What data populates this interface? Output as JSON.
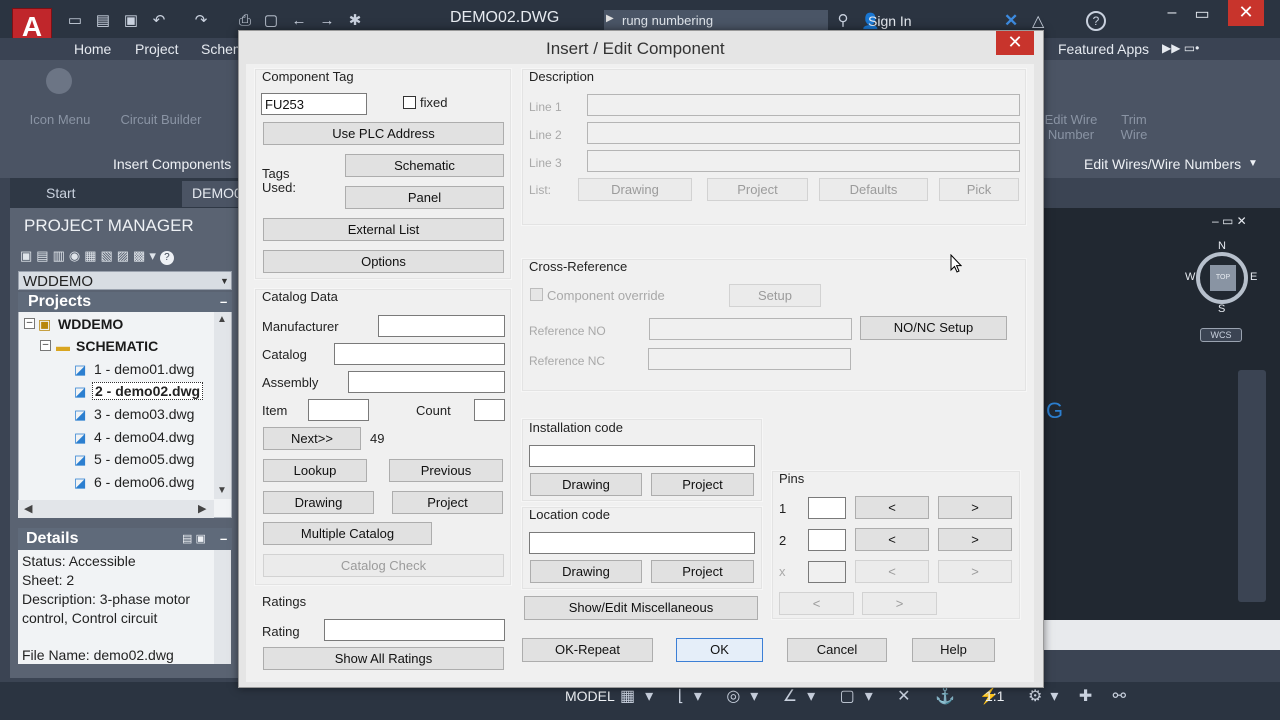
{
  "app": {
    "logo": "A",
    "file_title": "DEMO02.DWG",
    "search_text": "rung numbering",
    "sign_in": "Sign In",
    "tabs": [
      "Home",
      "Project",
      "Schem"
    ],
    "featured_apps": "Featured Apps",
    "ribbon_panel_insert": "Insert Components",
    "ribbon_panel_wires": "Edit Wires/Wire Numbers",
    "ribbon_faded": [
      "Icon Menu",
      "Circuit Builder",
      "Edit Wire Number",
      "Trim Wire"
    ],
    "doc_tabs": [
      "Start",
      "DEMO0"
    ],
    "status_model": "MODEL",
    "status_scale": "1:1"
  },
  "project_manager": {
    "title": "PROJECT MANAGER",
    "project_select": "WDDEMO",
    "projects_header": "Projects",
    "tree": {
      "project": "WDDEMO",
      "folder": "SCHEMATIC",
      "files": [
        "1 - demo01.dwg",
        "2 - demo02.dwg",
        "3 - demo03.dwg",
        "4 - demo04.dwg",
        "5 - demo05.dwg",
        "6 - demo06.dwg"
      ],
      "selected_index": 1
    },
    "details": {
      "header": "Details",
      "status": "Status: Accessible",
      "sheet": "Sheet: 2",
      "description": "Description: 3-phase motor control, Control circuit",
      "file_name": "File Name: demo02.dwg"
    }
  },
  "viewcube": {
    "top": "TOP",
    "n": "N",
    "s": "S",
    "e": "E",
    "w": "W",
    "wcs": "WCS"
  },
  "dialog": {
    "title": "Insert / Edit Component",
    "component_tag": {
      "header": "Component Tag",
      "value": "FU253",
      "fixed_label": "fixed",
      "use_plc_address": "Use PLC Address",
      "tags_used_label": "Tags Used:",
      "schematic": "Schematic",
      "panel": "Panel",
      "external_list": "External List",
      "options": "Options"
    },
    "catalog": {
      "header": "Catalog Data",
      "manufacturer_label": "Manufacturer",
      "catalog_label": "Catalog",
      "assembly_label": "Assembly",
      "item_label": "Item",
      "count_label": "Count",
      "next": "Next>>",
      "next_value": "49",
      "lookup": "Lookup",
      "previous": "Previous",
      "drawing": "Drawing",
      "project": "Project",
      "multiple_catalog": "Multiple Catalog",
      "catalog_check": "Catalog Check"
    },
    "ratings": {
      "header": "Ratings",
      "rating_label": "Rating",
      "show_all": "Show All Ratings"
    },
    "description": {
      "header": "Description",
      "line1": "Line 1",
      "line2": "Line 2",
      "line3": "Line 3",
      "list_label": "List:",
      "drawing": "Drawing",
      "project": "Project",
      "defaults": "Defaults",
      "pick": "Pick"
    },
    "cross_reference": {
      "header": "Cross-Reference",
      "component_override": "Component override",
      "setup": "Setup",
      "reference_no": "Reference NO",
      "reference_nc": "Reference NC",
      "nonc_setup": "NO/NC Setup"
    },
    "installation": {
      "header": "Installation code",
      "drawing": "Drawing",
      "project": "Project"
    },
    "location": {
      "header": "Location code",
      "drawing": "Drawing",
      "project": "Project"
    },
    "show_edit_misc": "Show/Edit Miscellaneous",
    "pins": {
      "header": "Pins",
      "row1": "1",
      "row2": "2",
      "row3": "x",
      "prev": "<",
      "next": ">"
    },
    "buttons": {
      "ok_repeat": "OK-Repeat",
      "ok": "OK",
      "cancel": "Cancel",
      "help": "Help"
    }
  }
}
